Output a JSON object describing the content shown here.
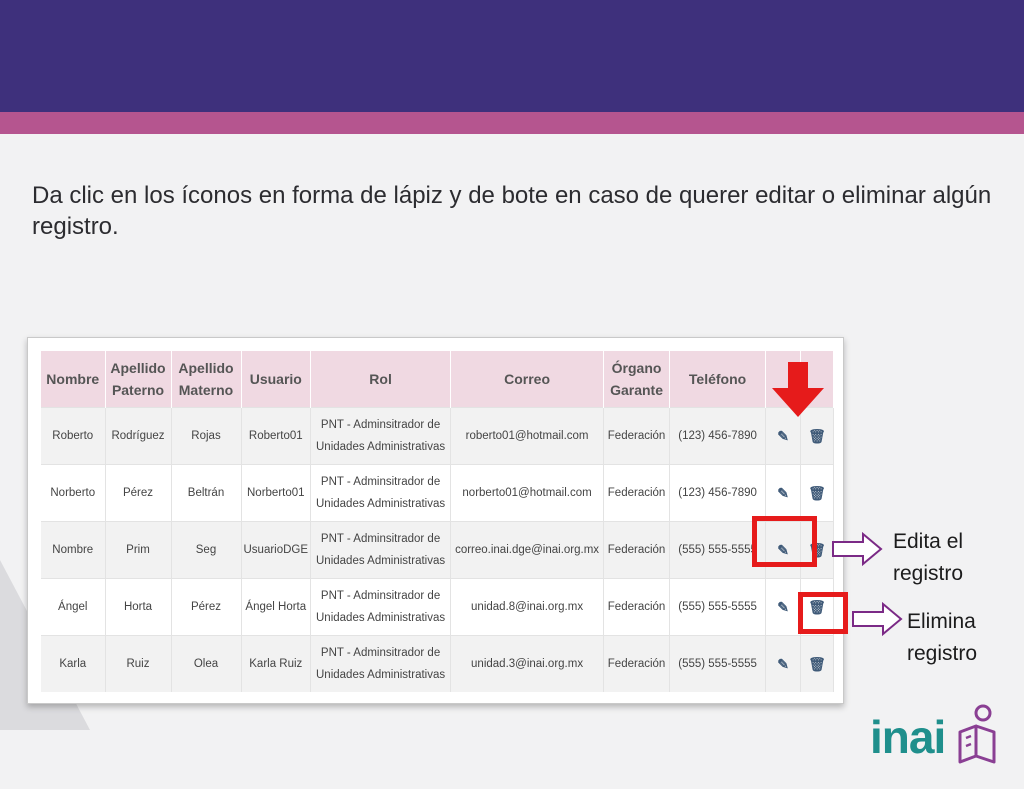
{
  "instruction": "Da clic en los íconos en forma de lápiz y de bote en caso de querer editar o eliminar algún registro.",
  "table": {
    "headers": [
      "Nombre",
      "Apellido\nPaterno",
      "Apellido\nMaterno",
      "Usuario",
      "Rol",
      "Correo",
      "Órgano\nGarante",
      "Teléfono",
      "",
      ""
    ],
    "rows": [
      [
        "Roberto",
        "Rodríguez",
        "Rojas",
        "Roberto01",
        "PNT - Adminsitrador de Unidades Administrativas",
        "roberto01@hotmail.com",
        "Federación",
        "(123) 456-7890"
      ],
      [
        "Norberto",
        "Pérez",
        "Beltrán",
        "Norberto01",
        "PNT - Adminsitrador de Unidades Administrativas",
        "norberto01@hotmail.com",
        "Federación",
        "(123) 456-7890"
      ],
      [
        "Nombre",
        "Prim",
        "Seg",
        "UsuarioDGE",
        "PNT - Adminsitrador de Unidades Administrativas",
        "correo.inai.dge@inai.org.mx",
        "Federación",
        "(555) 555-5555"
      ],
      [
        "Ángel",
        "Horta",
        "Pérez",
        "Ángel Horta",
        "PNT - Adminsitrador de Unidades Administrativas",
        "unidad.8@inai.org.mx",
        "Federación",
        "(555) 555-5555"
      ],
      [
        "Karla",
        "Ruiz",
        "Olea",
        "Karla Ruiz",
        "PNT - Adminsitrador de Unidades Administrativas",
        "unidad.3@inai.org.mx",
        "Federación",
        "(555) 555-5555"
      ]
    ],
    "edit_icon": "pencil-icon",
    "delete_icon": "trash-icon"
  },
  "callouts": {
    "edit": "Edita el registro",
    "delete": "Elimina registro"
  },
  "logo": {
    "text": "inai",
    "icon": "book-person-icon"
  },
  "colors": {
    "header_band": "#3e307c",
    "accent_band": "#b5558f",
    "table_header": "#f0d9e2",
    "highlight": "#e61b1b",
    "arrow_outline": "#7b2a86",
    "logo": "#1f8f8c"
  }
}
